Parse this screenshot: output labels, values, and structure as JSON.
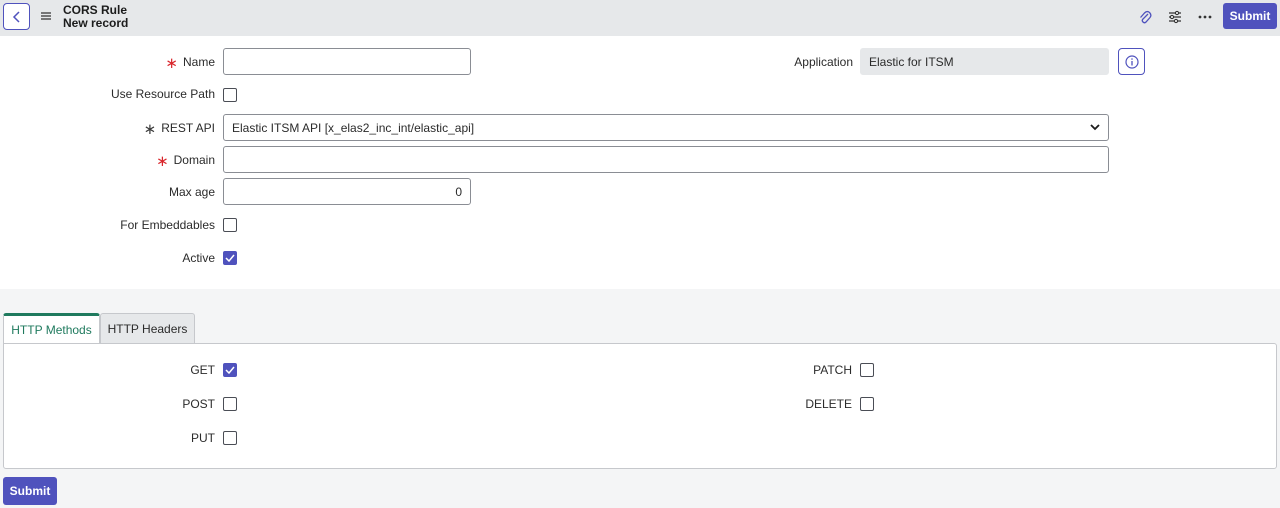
{
  "header": {
    "title": "CORS Rule",
    "subtitle": "New record",
    "submit_label": "Submit",
    "icons": [
      "chevron-left-icon",
      "hamburger-icon",
      "paperclip-icon",
      "sliders-icon",
      "more-icon"
    ]
  },
  "form": {
    "name": {
      "label": "Name",
      "required": true,
      "value": ""
    },
    "use_resource_path": {
      "label": "Use Resource Path",
      "checked": false
    },
    "rest_api": {
      "label": "REST API",
      "value": "Elastic ITSM API [x_elas2_inc_int/elastic_api]"
    },
    "domain": {
      "label": "Domain",
      "required": true,
      "value": ""
    },
    "max_age": {
      "label": "Max age",
      "value": "0"
    },
    "for_embeddables": {
      "label": "For Embeddables",
      "checked": false
    },
    "active": {
      "label": "Active",
      "checked": true
    },
    "application": {
      "label": "Application",
      "value": "Elastic for ITSM"
    },
    "required_marker": "∗"
  },
  "tabs": [
    {
      "label": "HTTP Methods",
      "active": true
    },
    {
      "label": "HTTP Headers",
      "active": false
    }
  ],
  "methods": {
    "get": {
      "label": "GET",
      "checked": true
    },
    "post": {
      "label": "POST",
      "checked": false
    },
    "put": {
      "label": "PUT",
      "checked": false
    },
    "patch": {
      "label": "PATCH",
      "checked": false
    },
    "delete": {
      "label": "DELETE",
      "checked": false
    }
  },
  "footer": {
    "submit_label": "Submit"
  },
  "colors": {
    "accent": "#4f52bd",
    "required": "#d9262c",
    "tab_active": "#1f7a5e",
    "header_bg": "#e6e8ea"
  }
}
